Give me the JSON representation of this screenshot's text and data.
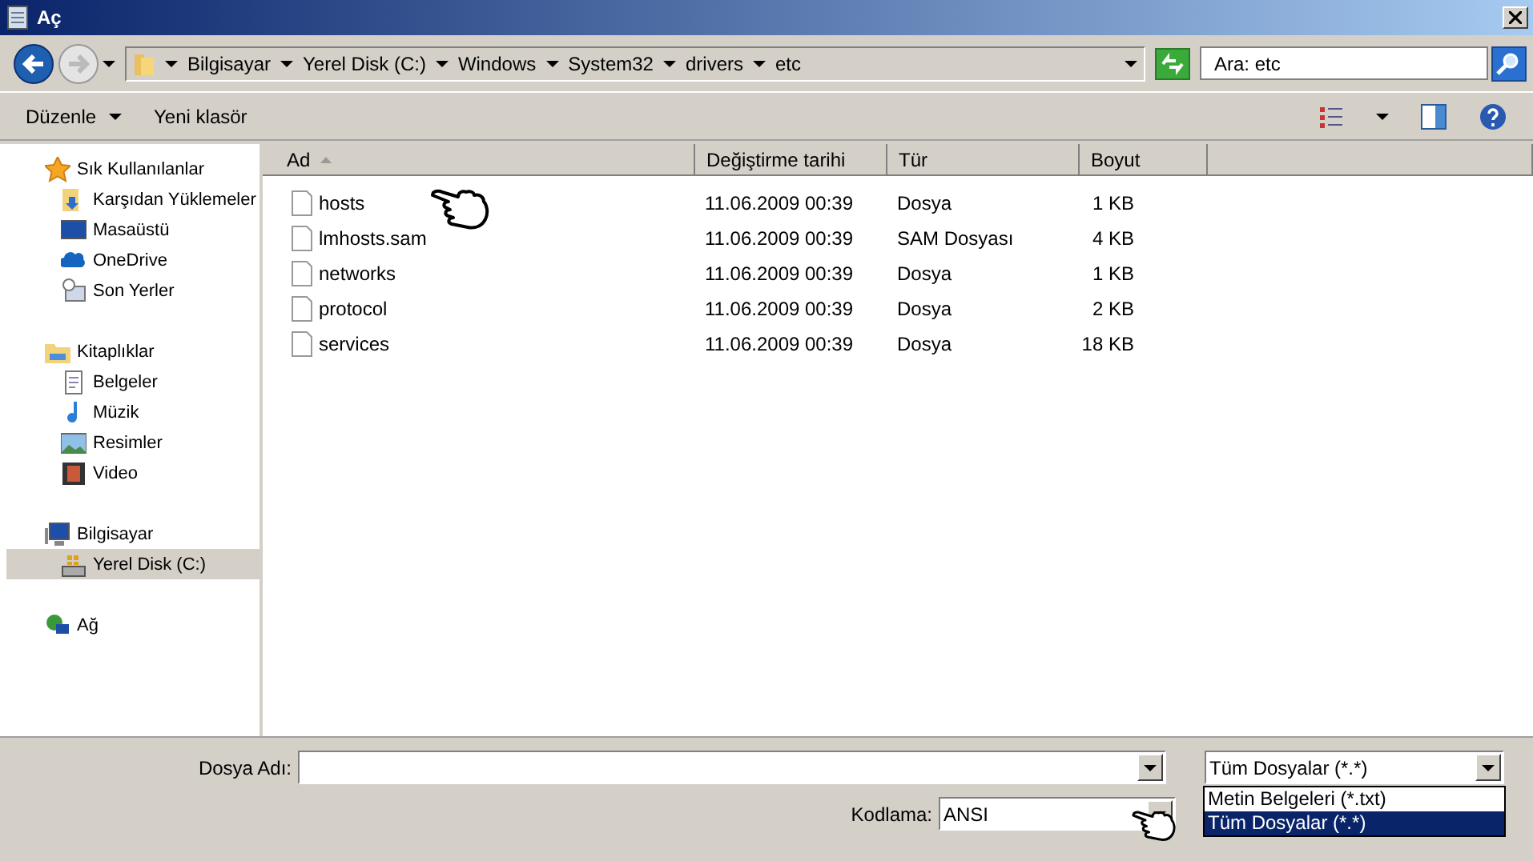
{
  "window": {
    "title": "Aç"
  },
  "nav": {
    "breadcrumb": [
      "Bilgisayar",
      "Yerel Disk (C:)",
      "Windows",
      "System32",
      "drivers",
      "etc"
    ],
    "search": {
      "placeholder": "Ara: etc"
    }
  },
  "toolbar": {
    "items": [
      {
        "label": "Düzenle",
        "kind": "menu"
      },
      {
        "label": "Yeni klasör",
        "kind": "plain"
      }
    ]
  },
  "sidebar": {
    "groups": [
      {
        "label": "Sık Kullanılanlar",
        "selected": false,
        "children": [
          {
            "label": "Karşıdan Yüklemeler",
            "selected": false
          },
          {
            "label": "Masaüstü",
            "selected": false
          },
          {
            "label": "OneDrive",
            "selected": false
          },
          {
            "label": "Son Yerler",
            "selected": false
          }
        ]
      },
      {
        "label": "Kitaplıklar",
        "selected": false,
        "children": [
          {
            "label": "Belgeler",
            "selected": false
          },
          {
            "label": "Müzik",
            "selected": false
          },
          {
            "label": "Resimler",
            "selected": false
          },
          {
            "label": "Video",
            "selected": false
          }
        ]
      },
      {
        "label": "Bilgisayar",
        "selected": false,
        "children": [
          {
            "label": "Yerel Disk (C:)",
            "selected": true
          }
        ]
      },
      {
        "label": "Ağ",
        "selected": false
      }
    ]
  },
  "table": {
    "columns": [
      {
        "label": "Ad",
        "sorted": true
      },
      {
        "label": "Değiştirme tarihi",
        "sorted": false
      },
      {
        "label": "Tür",
        "sorted": false
      },
      {
        "label": "Boyut",
        "sorted": false
      }
    ],
    "rows": [
      {
        "name": "hosts",
        "date": "11.06.2009 00:39",
        "type": "Dosya",
        "size": "1 KB"
      },
      {
        "name": "lmhosts.sam",
        "date": "11.06.2009 00:39",
        "type": "SAM Dosyası",
        "size": "4 KB"
      },
      {
        "name": "networks",
        "date": "11.06.2009 00:39",
        "type": "Dosya",
        "size": "1 KB"
      },
      {
        "name": "protocol",
        "date": "11.06.2009 00:39",
        "type": "Dosya",
        "size": "2 KB"
      },
      {
        "name": "services",
        "date": "11.06.2009 00:39",
        "type": "Dosya",
        "size": "18 KB"
      }
    ]
  },
  "bottom": {
    "filename": {
      "label": "Dosya Adı:"
    },
    "filetype": {
      "value": "Tüm Dosyalar  (*.*)",
      "expanded": true,
      "options": [
        {
          "label": "Metin Belgeleri (*.txt)",
          "selected": false
        },
        {
          "label": "Tüm Dosyalar  (*.*)",
          "selected": true
        }
      ]
    },
    "encoding": {
      "label": "Kodlama:",
      "value": "ANSI"
    }
  }
}
